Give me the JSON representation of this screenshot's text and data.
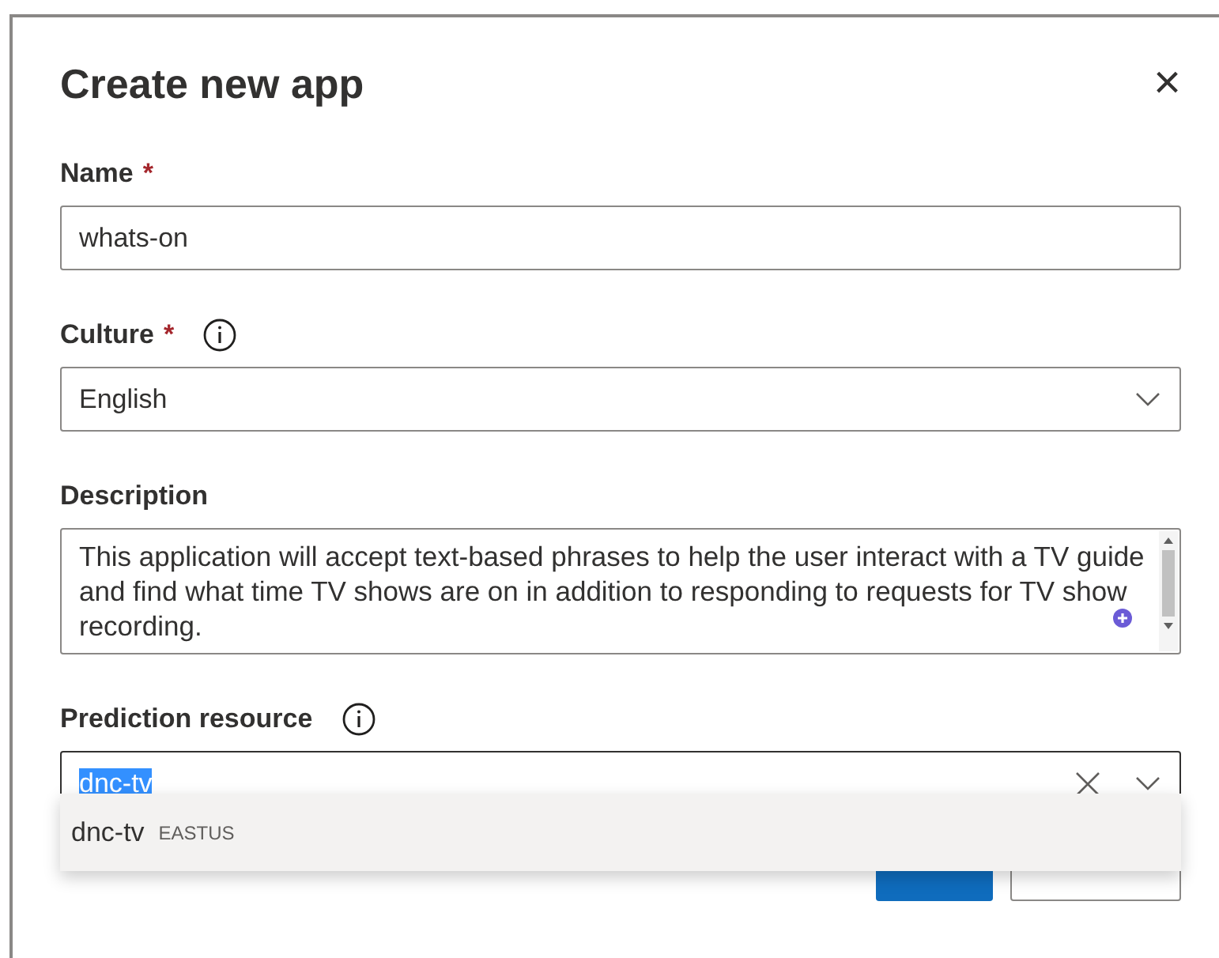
{
  "dialog": {
    "title": "Create new app",
    "close": "×"
  },
  "fields": [
    {
      "kind": "text",
      "label": "Name",
      "required_mark": "*",
      "info": false,
      "value": "whats-on"
    },
    {
      "kind": "select",
      "label": "Culture",
      "required_mark": "*",
      "info": true,
      "value": "English"
    },
    {
      "kind": "textarea",
      "label": "Description",
      "info": false,
      "value": "This application will accept text-based phrases to help the user interact with a TV guide and find what time TV shows are on in addition to responding to requests for TV show recording."
    },
    {
      "kind": "combobox",
      "label": "Prediction resource",
      "info": true,
      "value": "dnc-tv",
      "text_selected": true
    }
  ],
  "dropdown": {
    "options": [
      {
        "name": "dnc-tv",
        "region": "EASTUS"
      }
    ]
  },
  "buttons": [
    {
      "kind": "primary"
    },
    {
      "kind": "secondary"
    }
  ]
}
